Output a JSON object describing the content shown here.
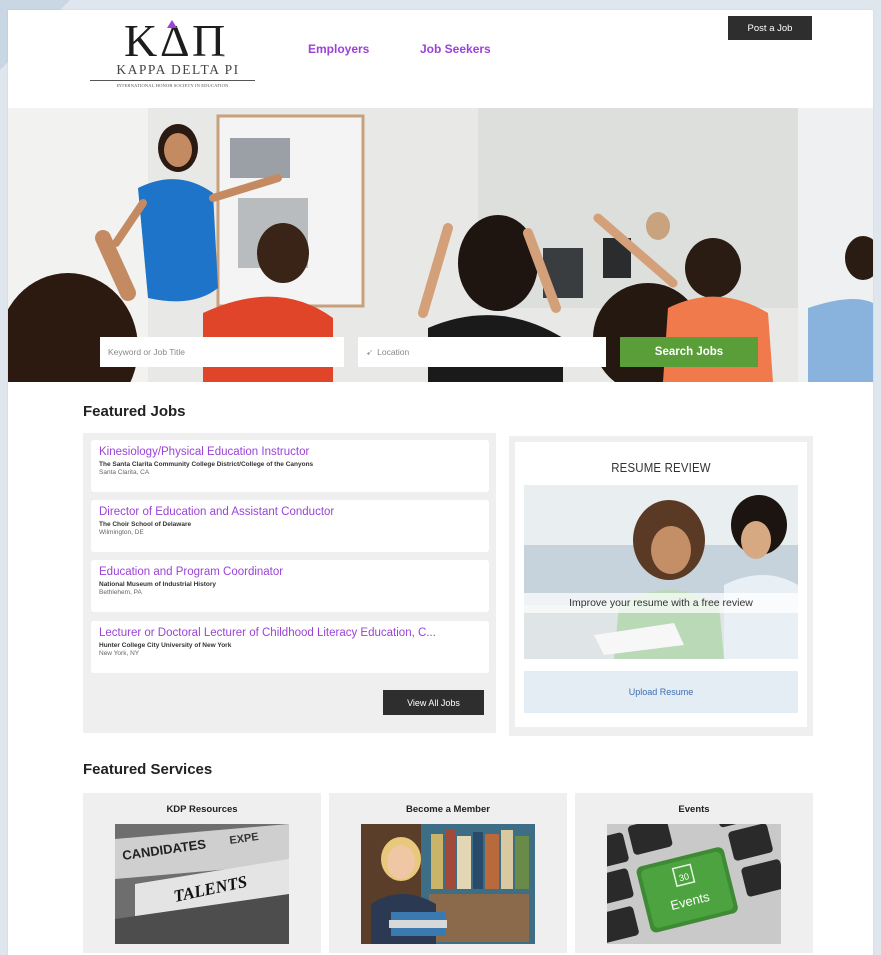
{
  "brand": {
    "logo_text": "KAPPA DELTA PI",
    "logo_subtitle": "INTERNATIONAL HONOR SOCIETY IN EDUCATION"
  },
  "nav": {
    "employers": "Employers",
    "job_seekers": "Job Seekers",
    "post_job": "Post a Job"
  },
  "search": {
    "keyword_placeholder": "Keyword or Job Title",
    "location_placeholder": "Location",
    "button": "Search Jobs"
  },
  "featured_jobs": {
    "heading": "Featured Jobs",
    "jobs": [
      {
        "title": "Kinesiology/Physical Education Instructor",
        "org": "The Santa Clarita Community College District/College of the Canyons",
        "location": "Santa Clarita, CA"
      },
      {
        "title": "Director of Education and Assistant Conductor",
        "org": "The Choir School of Delaware",
        "location": "Wilmington, DE"
      },
      {
        "title": "Education and Program Coordinator",
        "org": "National Museum of Industrial History",
        "location": "Bethlehem, PA"
      },
      {
        "title": "Lecturer or Doctoral Lecturer of Childhood Literacy Education, C...",
        "org": "Hunter College City University of New York",
        "location": "New York, NY"
      }
    ],
    "view_all": "View All Jobs"
  },
  "resume_review": {
    "title": "RESUME REVIEW",
    "caption": "Improve your resume with a free review",
    "button": "Upload Resume"
  },
  "featured_services": {
    "heading": "Featured Services",
    "items": [
      {
        "title": "KDP Resources",
        "image_text_1": "CANDIDATES",
        "image_text_2": "EXPE",
        "image_text_3": "TALENTS"
      },
      {
        "title": "Become a Member"
      },
      {
        "title": "Events",
        "image_text_1": "30",
        "image_text_2": "Events"
      }
    ]
  },
  "colors": {
    "accent": "#9b43d6",
    "search_button": "#5a9e3a",
    "dark_button": "#2e2e2e",
    "upload_text": "#3b6fb0"
  }
}
